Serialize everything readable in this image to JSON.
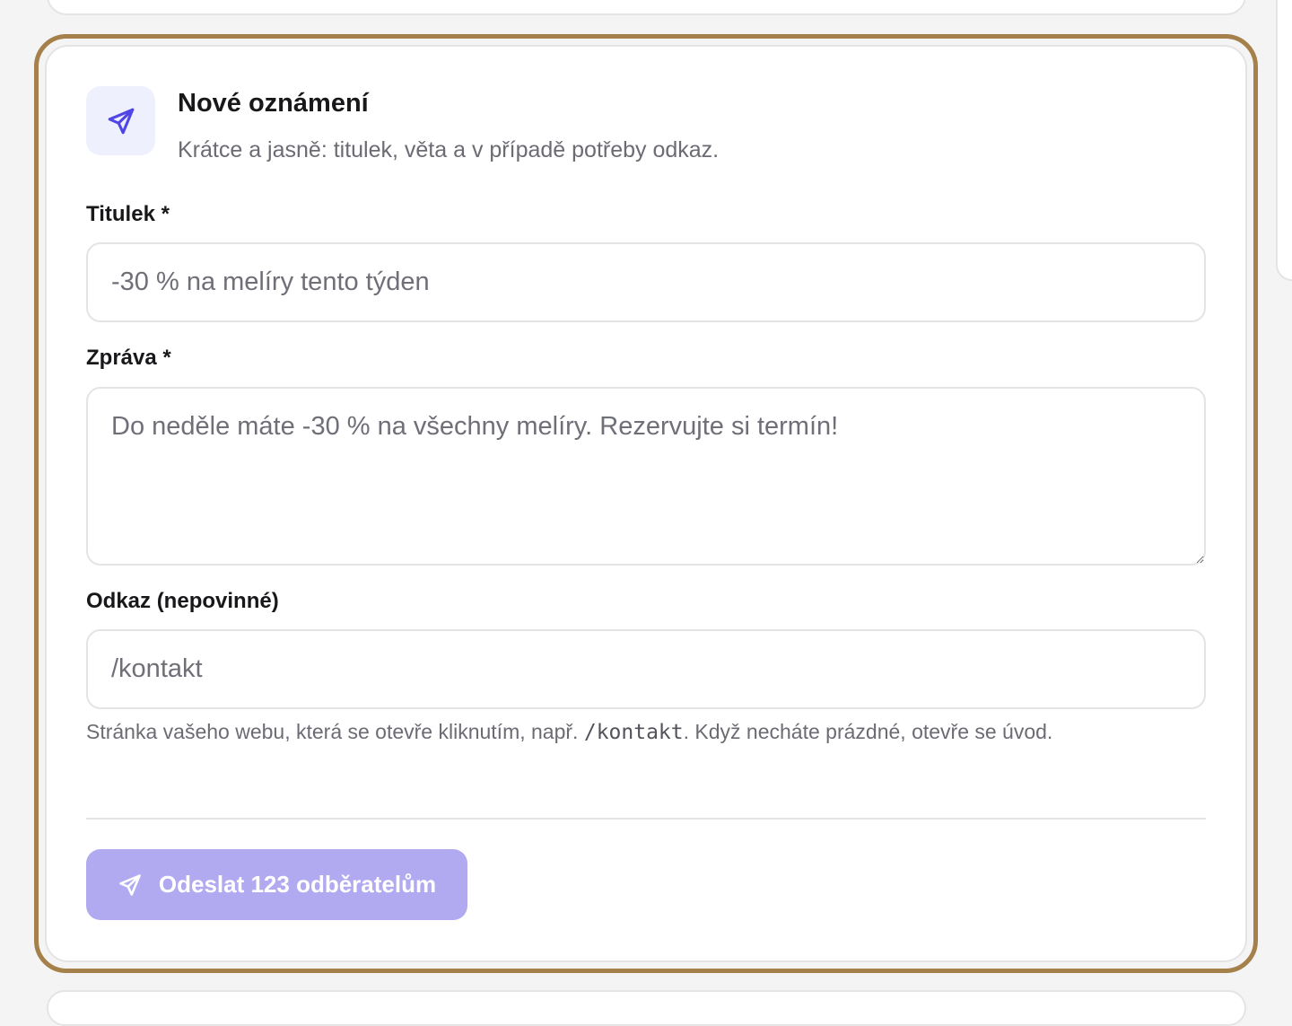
{
  "card": {
    "title": "Nové oznámení",
    "subtitle": "Krátce a jasně: titulek, věta a v případě potřeby odkaz.",
    "icon": "send-icon",
    "accent_color": "#4f46e5",
    "highlight_color": "#a6804a"
  },
  "form": {
    "title_label": "Titulek *",
    "title_placeholder": "-30 % na melíry tento týden",
    "message_label": "Zpráva *",
    "message_placeholder": "Do neděle máte -30 % na všechny melíry. Rezervujte si termín!",
    "link_label": "Odkaz (nepovinné)",
    "link_placeholder": "/kontakt",
    "link_hint_before": "Stránka vašeho webu, která se otevře kliknutím, např. ",
    "link_hint_code": "/kontakt",
    "link_hint_after": ". Když necháte prázdné, otevře se úvod."
  },
  "actions": {
    "send_label": "Odeslat 123 odběratelům",
    "send_color": "#b2aaf1"
  }
}
